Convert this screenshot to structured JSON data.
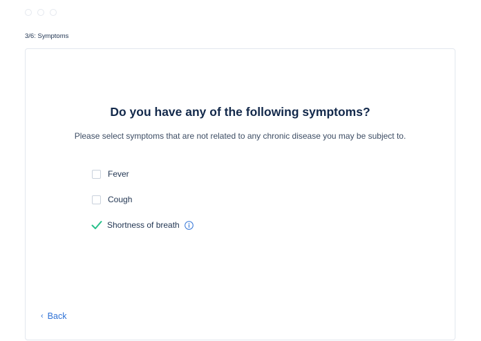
{
  "window": {
    "dots": [
      "dot",
      "dot",
      "dot"
    ]
  },
  "header": {
    "step_label": "3/6: Symptoms"
  },
  "question": {
    "title": "Do you have any of the following symptoms?",
    "subtitle": "Please select symptoms that are not related to any chronic disease you may be subject to."
  },
  "options": [
    {
      "label": "Fever",
      "checked": false
    },
    {
      "label": "Cough",
      "checked": false
    },
    {
      "label": "Shortness of breath",
      "checked": true,
      "has_info": true
    }
  ],
  "navigation": {
    "back_label": "Back",
    "back_icon": "chevron-left-icon"
  },
  "colors": {
    "accent": "#2f72d6",
    "check": "#27c08a",
    "title": "#13294b"
  }
}
